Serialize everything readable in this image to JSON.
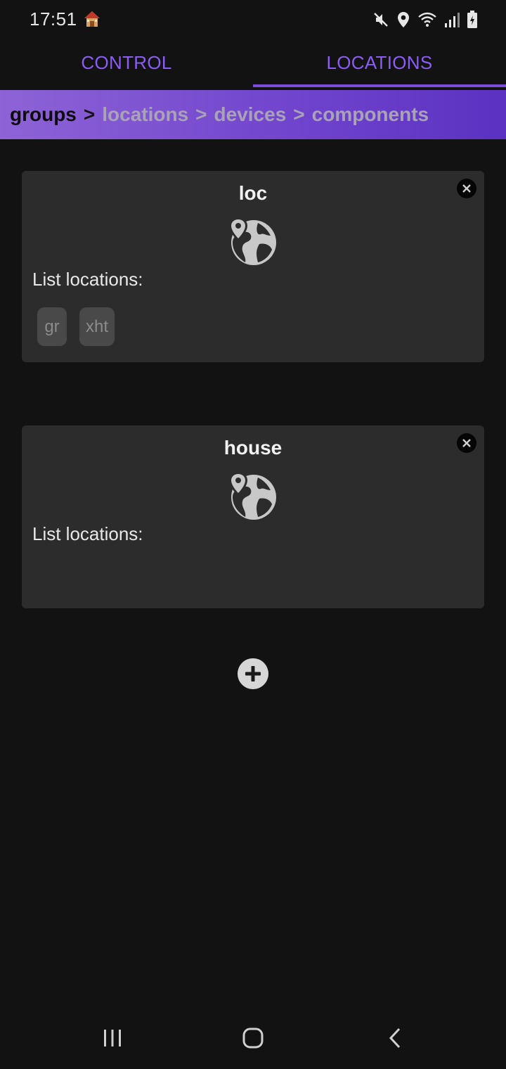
{
  "status_bar": {
    "time": "17:51",
    "icons": [
      "home-emoji-icon",
      "mute-icon",
      "location-pin-icon",
      "wifi-icon",
      "signal-icon",
      "battery-icon"
    ]
  },
  "tabs": [
    {
      "label": "CONTROL",
      "selected": false
    },
    {
      "label": "LOCATIONS",
      "selected": true
    }
  ],
  "breadcrumb": {
    "items": [
      "groups",
      "locations",
      "devices",
      "components"
    ],
    "separator": ">",
    "active_index": 0
  },
  "cards": [
    {
      "title": "loc",
      "list_label": "List locations:",
      "chips": [
        "gr",
        "xht"
      ]
    },
    {
      "title": "house",
      "list_label": "List locations:",
      "chips": []
    }
  ],
  "colors": {
    "accent": "#8b5cf6",
    "background": "#121212",
    "card": "#2c2c2c",
    "chip": "#494949"
  }
}
